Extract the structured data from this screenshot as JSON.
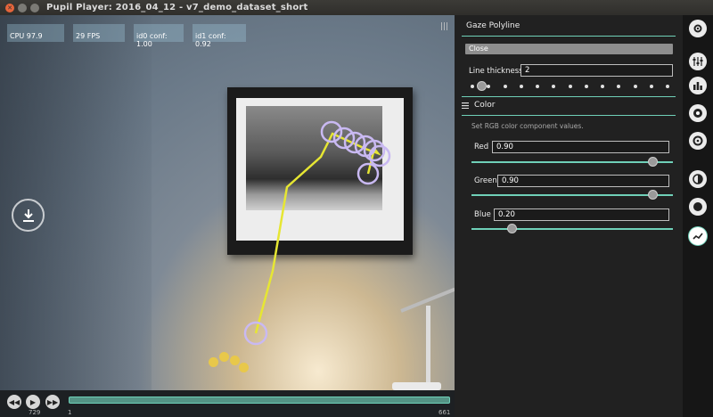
{
  "window": {
    "title": "Pupil Player: 2016_04_12 - v7_demo_dataset_short"
  },
  "video": {
    "stats": {
      "cpu": "CPU 97.9",
      "fps": "29 FPS",
      "id0_conf": "id0 conf: 1.00",
      "id1_conf": "id1 conf: 0.92"
    },
    "menu_glyph": "|||"
  },
  "timeline": {
    "frame_total": "729",
    "frame_current_label": "1",
    "frame_end_label": "661",
    "buttons": [
      "rewind-icon",
      "play-icon",
      "fast-forward-icon"
    ],
    "progress": 1.0
  },
  "panel": {
    "title": "Gaze Polyline",
    "close_label": "Close",
    "line_thickness_label": "Line thickness",
    "line_thickness_value": "2",
    "line_thickness_slider": 0.05,
    "color_section_label": "Color",
    "color_description": "Set RGB color component values.",
    "red_label": "Red",
    "red_value": "0.90",
    "green_label": "Green",
    "green_value": "0.90",
    "blue_label": "Blue",
    "blue_value": "0.20"
  },
  "iconbar": {
    "icons": [
      "settings-icon",
      "plugins-icon",
      "statistics-icon",
      "vis-circle-icon",
      "vis-cross-icon",
      "fixation-icon",
      "vis-polyline-active-icon"
    ]
  },
  "colors": {
    "accent": "#6fd0b8",
    "gaze_line": "#e6e633",
    "gaze_circle": "#c9b9f2"
  }
}
